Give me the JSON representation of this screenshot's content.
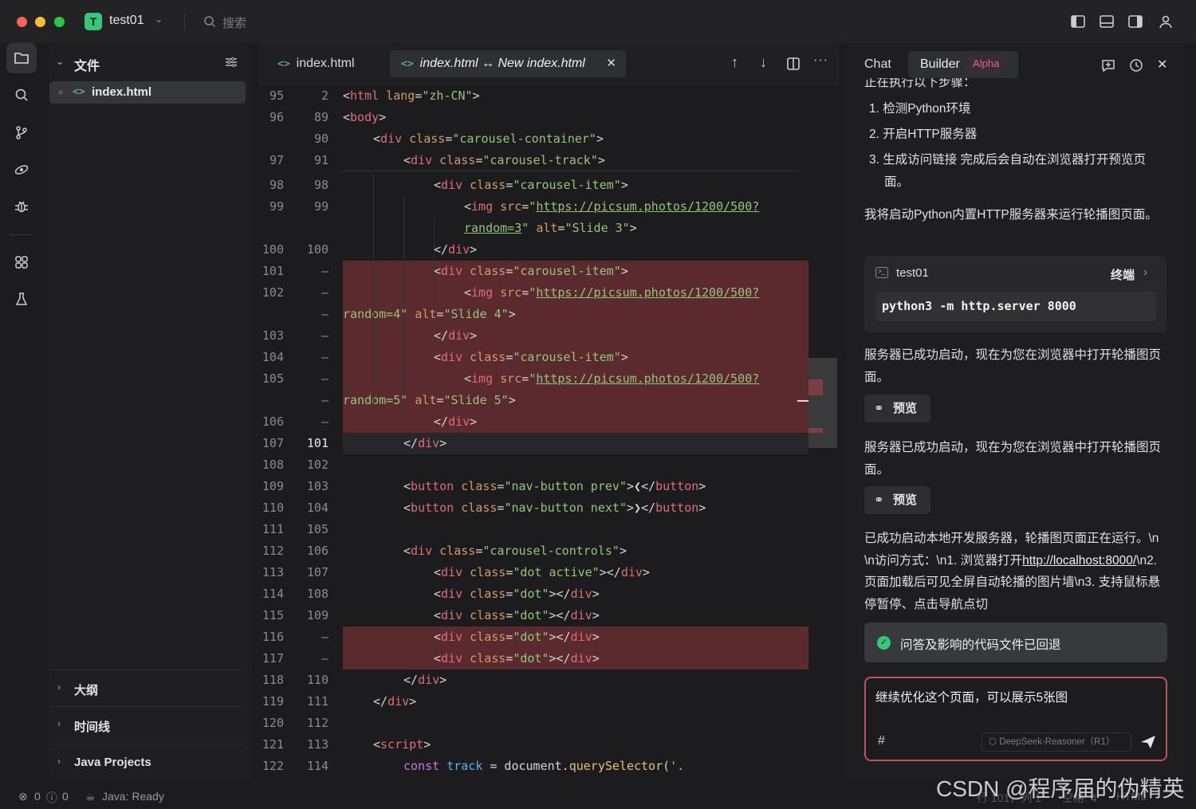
{
  "titlebar": {
    "project_initial": "T",
    "project_name": "test01",
    "search_placeholder": "搜索"
  },
  "explorer": {
    "title": "文件",
    "file": "index.html",
    "sections": [
      "大纲",
      "时间线",
      "Java Projects"
    ]
  },
  "editor": {
    "tabs": [
      {
        "label": "index.html",
        "active": false
      },
      {
        "label": "index.html ↔ New index.html",
        "active": true
      }
    ],
    "lines": [
      {
        "l": "95",
        "r": "2",
        "text": "<html lang=\"zh-CN\">"
      },
      {
        "l": "96",
        "r": "89",
        "text": "<body>"
      },
      {
        "l": "",
        "r": "90",
        "text": "<div class=\"carousel-container\">"
      },
      {
        "l": "97",
        "r": "91",
        "text": "<div class=\"carousel-track\">"
      },
      {
        "l": "98",
        "r": "98",
        "text": "<div class=\"carousel-item\">"
      },
      {
        "l": "99",
        "r": "99",
        "text": "<img src=\"https://picsum.photos/1200/500?"
      },
      {
        "l": "",
        "r": "",
        "text": "random=3\" alt=\"Slide 3\">"
      },
      {
        "l": "100",
        "r": "100",
        "text": "</div>"
      },
      {
        "l": "101",
        "r": "—",
        "text": "<div class=\"carousel-item\">"
      },
      {
        "l": "102",
        "r": "—",
        "text": "<img src=\"https://picsum.photos/1200/500?"
      },
      {
        "l": "",
        "r": "—",
        "text": "random=4\" alt=\"Slide 4\">"
      },
      {
        "l": "103",
        "r": "—",
        "text": "</div>"
      },
      {
        "l": "104",
        "r": "—",
        "text": "<div class=\"carousel-item\">"
      },
      {
        "l": "105",
        "r": "—",
        "text": "<img src=\"https://picsum.photos/1200/500?"
      },
      {
        "l": "",
        "r": "—",
        "text": "random=5\" alt=\"Slide 5\">"
      },
      {
        "l": "106",
        "r": "—",
        "text": "</div>"
      },
      {
        "l": "107",
        "r": "101",
        "text": "</div>"
      },
      {
        "l": "108",
        "r": "102",
        "text": ""
      },
      {
        "l": "109",
        "r": "103",
        "text": "<button class=\"nav-button prev\">❮</button>"
      },
      {
        "l": "110",
        "r": "104",
        "text": "<button class=\"nav-button next\">❯</button>"
      },
      {
        "l": "111",
        "r": "105",
        "text": ""
      },
      {
        "l": "112",
        "r": "106",
        "text": "<div class=\"carousel-controls\">"
      },
      {
        "l": "113",
        "r": "107",
        "text": "<div class=\"dot active\"></div>"
      },
      {
        "l": "114",
        "r": "108",
        "text": "<div class=\"dot\"></div>"
      },
      {
        "l": "115",
        "r": "109",
        "text": "<div class=\"dot\"></div>"
      },
      {
        "l": "116",
        "r": "—",
        "text": "<div class=\"dot\"></div>"
      },
      {
        "l": "117",
        "r": "—",
        "text": "<div class=\"dot\"></div>"
      },
      {
        "l": "118",
        "r": "110",
        "text": "</div>"
      },
      {
        "l": "119",
        "r": "111",
        "text": "</div>"
      },
      {
        "l": "120",
        "r": "112",
        "text": ""
      },
      {
        "l": "121",
        "r": "113",
        "text": "<script>"
      },
      {
        "l": "122",
        "r": "114",
        "text": "const track = document.querySelector('."
      }
    ]
  },
  "chat": {
    "tab_chat": "Chat",
    "tab_builder": "Builder",
    "builder_badge": "Alpha",
    "partial_top": "正在执行以下步骤：",
    "steps": [
      "1. 检测Python环境",
      "2. 开启HTTP服务器",
      "3. 生成访问链接 完成后会自动在浏览器打开预览页面。"
    ],
    "msg1": "我将启动Python内置HTTP服务器来运行轮播图页面。",
    "terminal_title": "test01",
    "terminal_link": "终端",
    "terminal_cmd": "python3 -m http.server 8000",
    "msg2": "服务器已成功启动，现在为您在浏览器中打开轮播图页面。",
    "preview_label": "预览",
    "msg3": "服务器已成功启动，现在为您在浏览器中打开轮播图页面。",
    "msg4_a": "已成功启动本地开发服务器，轮播图页面正在运行。\\n\\n访问方式：\\n1. 浏览器打开",
    "msg4_link": "http://localhost:8000/",
    "msg4_b": "\\n2. 页面加载后可见全屏自动轮播的图片墙\\n3. 支持鼠标悬停暂停、点击导航点切",
    "toast": "问答及影响的代码文件已回退",
    "input_text": "继续优化这个页面，可以展示5张图",
    "input_hash": "#",
    "model": "DeepSeek-Reasoner（R1）"
  },
  "status": {
    "errors": "0",
    "warnings": "0",
    "java": "Java: Ready",
    "position": "行 101，列 1",
    "indent": "空格: 4",
    "lang": "HTML"
  },
  "watermark": "CSDN @程序届的伪精英"
}
